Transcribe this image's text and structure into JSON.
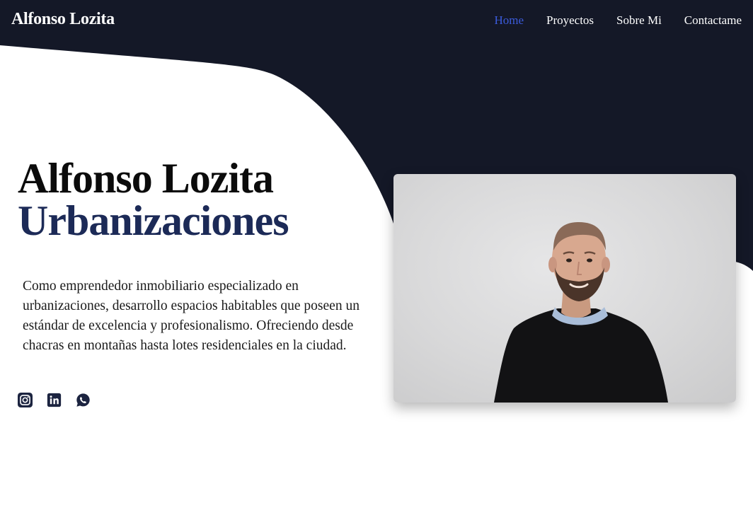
{
  "colors": {
    "navy": "#141827",
    "accent_link": "#3b5bdb",
    "title_dark": "#0b0b0b",
    "title_blue": "#1c2a57",
    "icon_color": "#1c2440"
  },
  "navbar": {
    "brand": "Alfonso Lozita",
    "links": [
      {
        "label": "Home",
        "active": true
      },
      {
        "label": "Proyectos",
        "active": false
      },
      {
        "label": "Sobre Mi",
        "active": false
      },
      {
        "label": "Contactame",
        "active": false
      }
    ]
  },
  "hero": {
    "title_line1": "Alfonso Lozita",
    "title_line2": "Urbanizaciones",
    "description": "Como emprendedor inmobiliario especializado en urbanizaciones, desarrollo espacios habitables que poseen un estándar de excelencia y profesionalismo. Ofreciendo desde chacras en montañas hasta lotes residenciales en la ciudad."
  },
  "socials": [
    {
      "icon": "instagram-icon"
    },
    {
      "icon": "linkedin-icon"
    },
    {
      "icon": "whatsapp-icon"
    }
  ],
  "photo": {
    "subject": "portrait-photo"
  }
}
